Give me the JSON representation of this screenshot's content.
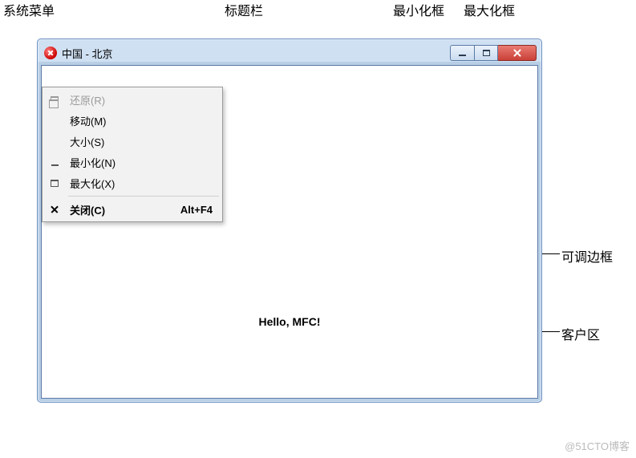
{
  "labels": {
    "system_menu": "系统菜单",
    "title_bar": "标题栏",
    "minimize_box": "最小化框",
    "maximize_box": "最大化框",
    "resizable_border": "可调边框",
    "client_area": "客户区"
  },
  "window": {
    "title": "中国 - 北京",
    "client_text": "Hello, MFC!"
  },
  "system_menu": {
    "restore": "还原(R)",
    "move": "移动(M)",
    "size": "大小(S)",
    "minimize": "最小化(N)",
    "maximize": "最大化(X)",
    "close": "关闭(C)",
    "close_shortcut": "Alt+F4"
  },
  "watermark": "@51CTO博客"
}
